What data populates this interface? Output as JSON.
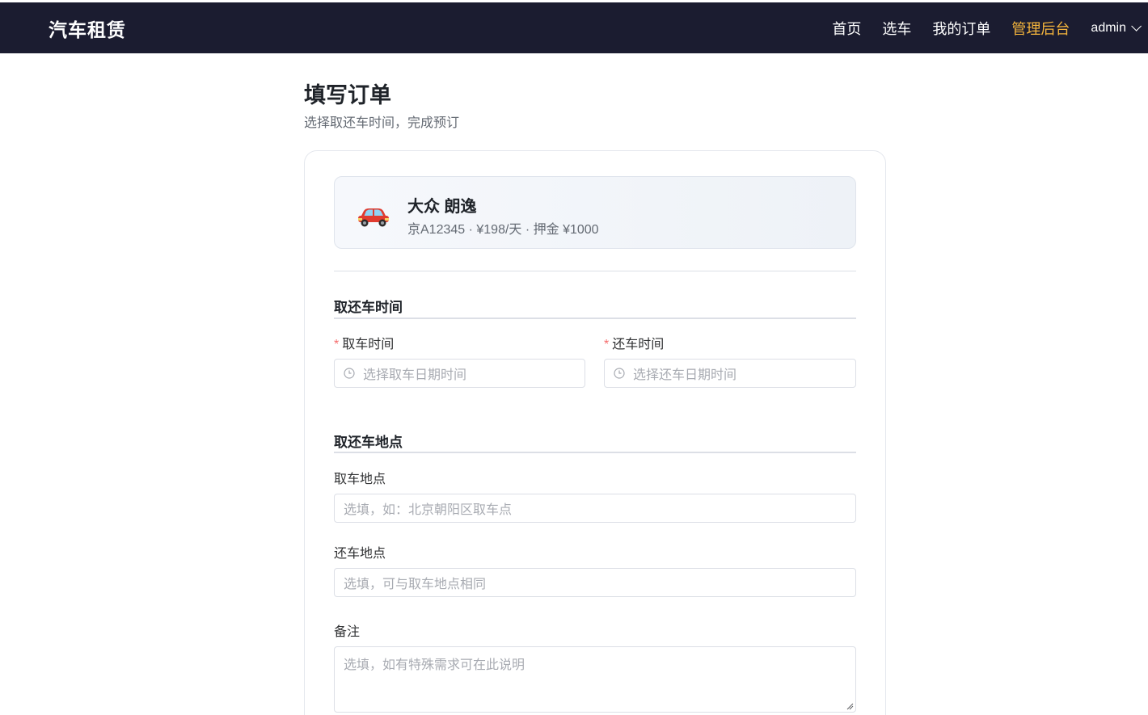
{
  "header": {
    "brand": "汽车租赁",
    "nav": [
      "首页",
      "选车",
      "我的订单",
      "管理后台"
    ],
    "active_nav": "管理后台",
    "user": "admin",
    "bg_color": "#1b1c30",
    "accent_color": "#f5b53c"
  },
  "page": {
    "title": "填写订单",
    "subtitle": "选择取还车时间，完成预订"
  },
  "car": {
    "icon": "car-icon",
    "name": "大众 朗逸",
    "meta": "京A12345 · ¥198/天 · 押金 ¥1000"
  },
  "time_section": {
    "title": "取还车时间",
    "pickup_label": "取车时间",
    "return_label": "还车时间",
    "required_mark": "*",
    "pickup_placeholder": "选择取车日期时间",
    "return_placeholder": "选择还车日期时间"
  },
  "place_section": {
    "title": "取还车地点",
    "pickup_label": "取车地点",
    "pickup_placeholder": "选填，如：北京朝阳区取车点",
    "return_label": "还车地点",
    "return_placeholder": "选填，可与取车地点相同",
    "notes_label": "备注",
    "notes_placeholder": "选填，如有特殊需求可在此说明"
  }
}
